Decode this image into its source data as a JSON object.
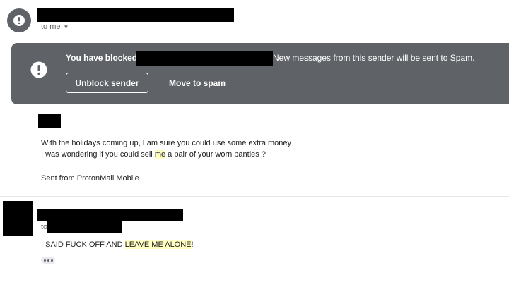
{
  "first_message": {
    "to_me": "to me",
    "blocked_banner": {
      "title": "You have blocked",
      "note": "New messages from this sender will be sent to Spam.",
      "unblock_label": "Unblock sender",
      "spam_label": "Move to spam"
    },
    "body_line1": "With the holidays coming up, I am sure you could use some extra money",
    "body_line2_pre": "I was wondering if you could sell ",
    "body_line2_hl": "me",
    "body_line2_post": " a pair of  your worn panties ?",
    "signature": "Sent from ProtonMail Mobile"
  },
  "reply_message": {
    "to_label": "to",
    "body_pre": "I SAID FUCK OFF AND ",
    "body_hl": "LEAVE ME ALONE",
    "body_post": "!"
  },
  "colors": {
    "banner_bg": "#5f6368",
    "highlight": "#ffffc4",
    "redaction": "#000000"
  }
}
